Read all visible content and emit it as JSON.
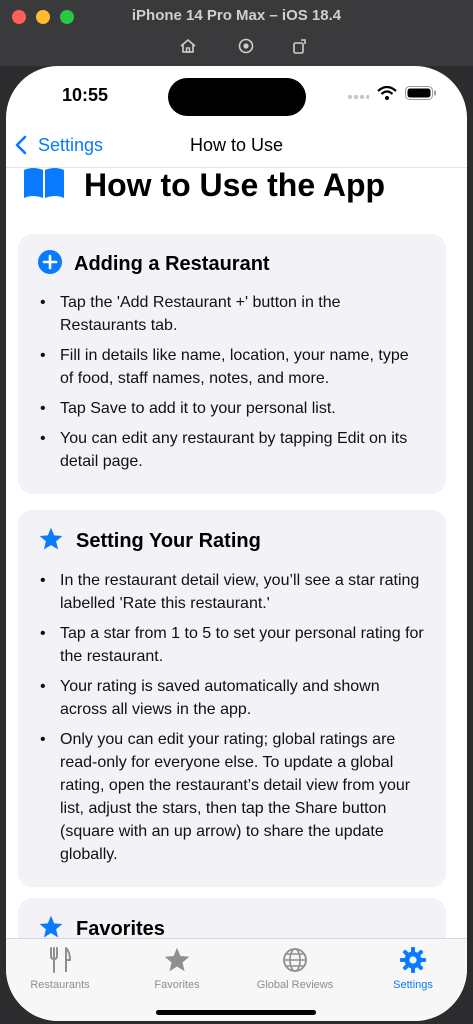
{
  "simulator": {
    "title": "iPhone 14 Pro Max – iOS 18.4",
    "buttons": [
      "home-icon",
      "screenshot-icon",
      "rotate-icon"
    ]
  },
  "status": {
    "time": "10:55"
  },
  "nav": {
    "back_label": "Settings",
    "title": "How to Use"
  },
  "page": {
    "heading": "How to Use the App",
    "heading_icon": "book-icon"
  },
  "sections": [
    {
      "title": "Adding a Restaurant",
      "icon": "plus-circle-icon",
      "bullets": [
        "Tap the 'Add Restaurant +' button in the Restaurants tab.",
        "Fill in details like name, location, your name, type of food, staff names, notes, and more.",
        "Tap Save to add it to your personal list.",
        "You can edit any restaurant by tapping Edit on its detail page."
      ]
    },
    {
      "title": "Setting Your Rating",
      "icon": "star-icon",
      "bullets": [
        "In the restaurant detail view, you’ll see a star rating labelled 'Rate this restaurant.'",
        "Tap a star from 1 to 5 to set your personal rating for the restaurant.",
        "Your rating is saved automatically and shown across all views in the app.",
        "Only you can edit your rating; global ratings are read-only for everyone else. To update a global rating, open the restaurant’s detail view from your list, adjust the stars, then tap the Share button (square with an up arrow) to share the update globally."
      ]
    },
    {
      "title": "Favorites",
      "icon": "star-icon",
      "bullets": []
    }
  ],
  "tabs": [
    {
      "label": "Restaurants",
      "icon": "fork-knife-icon",
      "active": false
    },
    {
      "label": "Favorites",
      "icon": "star-icon",
      "active": false
    },
    {
      "label": "Global Reviews",
      "icon": "globe-icon",
      "active": false
    },
    {
      "label": "Settings",
      "icon": "gear-icon",
      "active": true
    }
  ],
  "colors": {
    "accent": "#0a7aff",
    "card_bg": "#f2f2f7",
    "inactive": "#8e8e93"
  }
}
